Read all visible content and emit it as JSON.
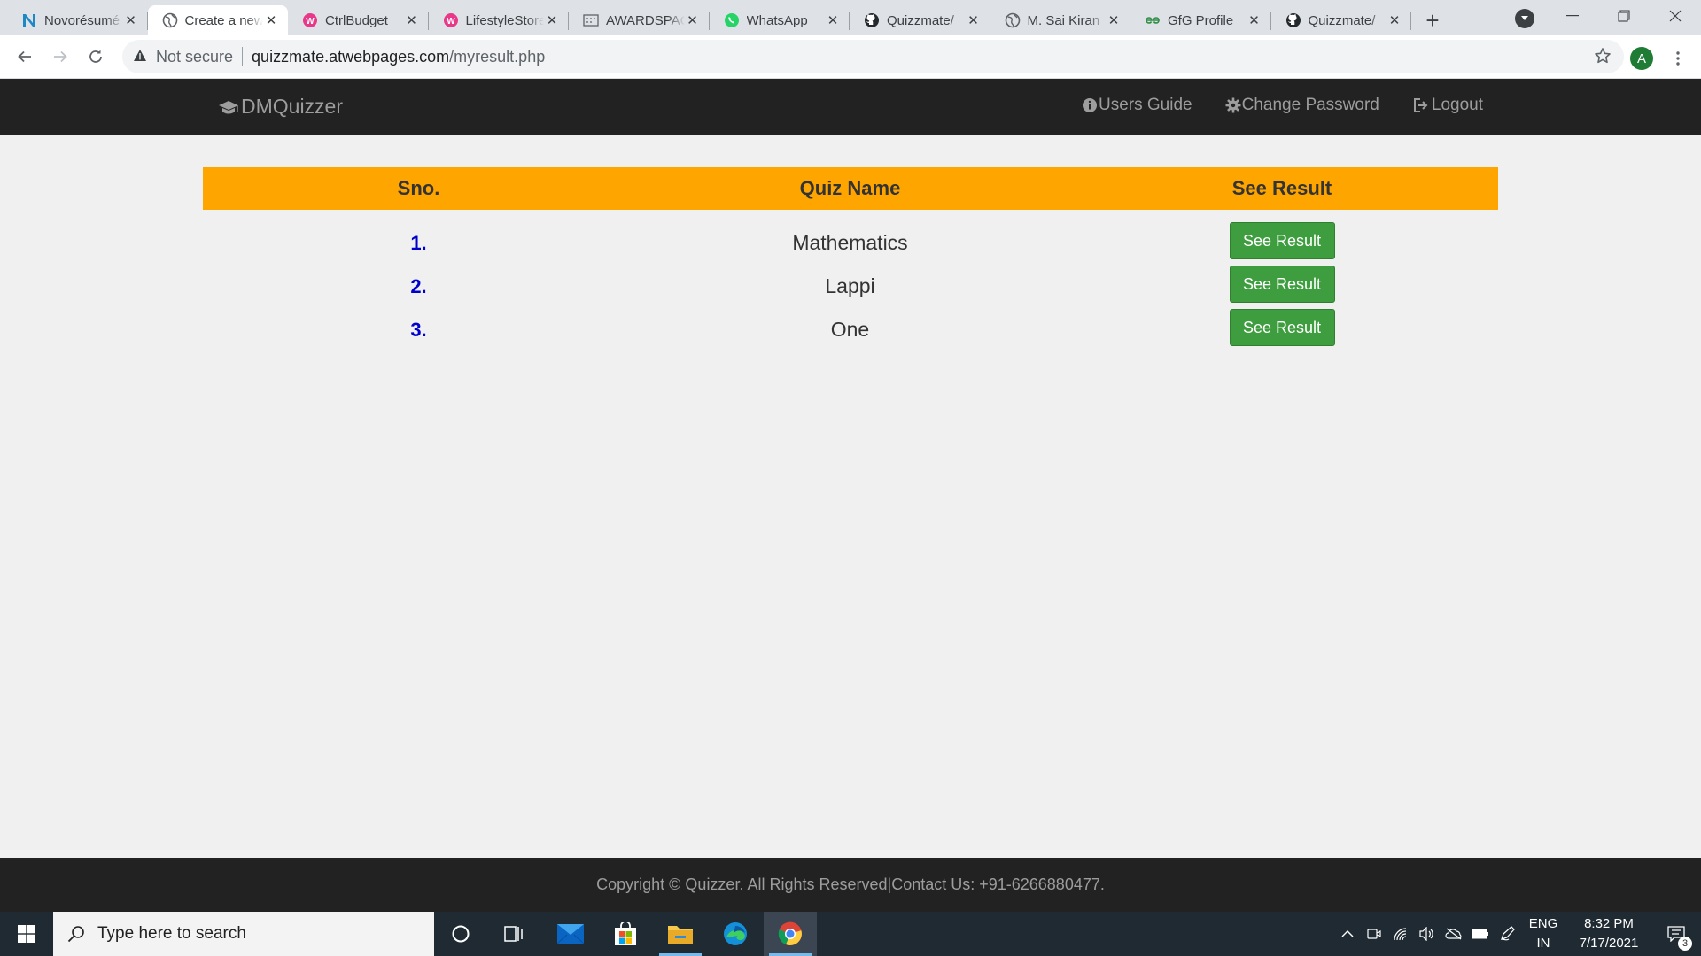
{
  "browser": {
    "tabs": [
      {
        "title": "Novorésumé",
        "icon": "novoresume-icon",
        "active": false
      },
      {
        "title": "Create a new",
        "icon": "globe-icon",
        "active": true
      },
      {
        "title": "CtrlBudget",
        "icon": "webpages-icon",
        "active": false
      },
      {
        "title": "LifestyleStore",
        "icon": "webpages-icon",
        "active": false
      },
      {
        "title": "AWARDSPACE",
        "icon": "awardspace-icon",
        "active": false
      },
      {
        "title": "WhatsApp",
        "icon": "whatsapp-icon",
        "active": false
      },
      {
        "title": "Quizzmate/",
        "icon": "github-icon",
        "active": false
      },
      {
        "title": "M. Sai Kiran",
        "icon": "globe-icon",
        "active": false
      },
      {
        "title": "GfG Profile",
        "icon": "gfg-icon",
        "active": false
      },
      {
        "title": "Quizzmate/",
        "icon": "github-icon",
        "active": false
      }
    ],
    "new_tab": "+",
    "security_label": "Not secure",
    "url_host": "quizzmate.atwebpages.com",
    "url_path": "/myresult.php",
    "profile_initial": "A"
  },
  "site": {
    "brand": "DMQuizzer",
    "nav": {
      "users_guide": "Users Guide",
      "change_password": "Change Password",
      "logout": "Logout"
    },
    "table": {
      "headers": [
        "Sno.",
        "Quiz Name",
        "See Result"
      ],
      "rows": [
        {
          "sno": "1.",
          "quiz": "Mathematics",
          "action": "See Result"
        },
        {
          "sno": "2.",
          "quiz": "Lappi",
          "action": "See Result"
        },
        {
          "sno": "3.",
          "quiz": "One",
          "action": "See Result"
        }
      ]
    },
    "footer": "Copyright © Quizzer. All Rights Reserved|Contact Us: +91-6266880477."
  },
  "taskbar": {
    "search_placeholder": "Type here to search",
    "lang_top": "ENG",
    "lang_bottom": "IN",
    "time": "8:32 PM",
    "date": "7/17/2021",
    "notification_count": "3"
  },
  "colors": {
    "table_header": "#ffa500",
    "navbar": "#222222",
    "button_green": "#3e9d3e",
    "sno_blue": "#0000cd"
  }
}
